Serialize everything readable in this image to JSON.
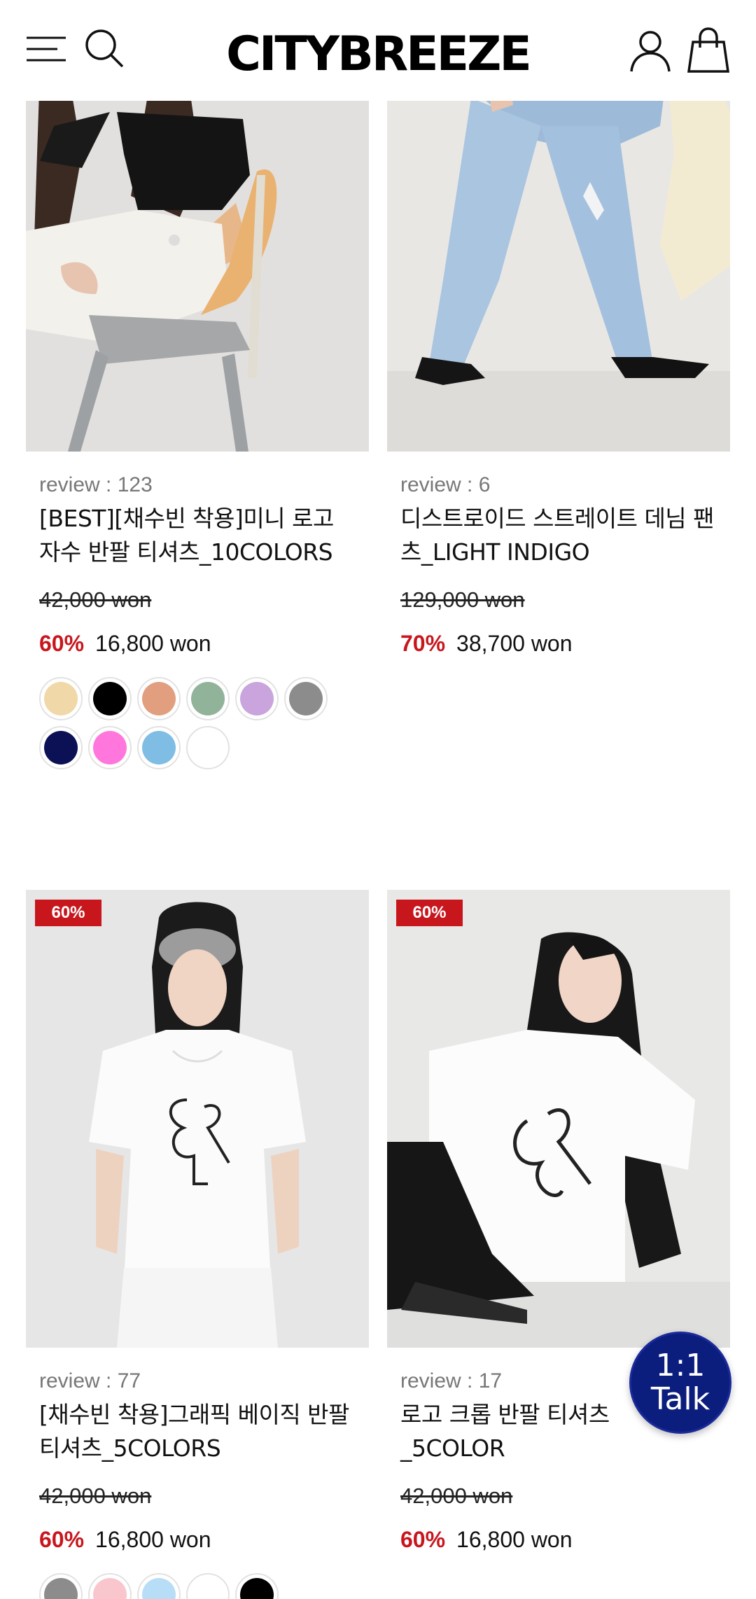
{
  "header": {
    "logo": "CITYBREEZE",
    "menu_icon": "hamburger-menu-icon",
    "search_icon": "search-icon",
    "user_icon": "user-icon",
    "cart_icon": "shopping-bag-icon"
  },
  "products": [
    {
      "review": "review : 123",
      "title_line1": "[BEST][채수빈 착용]미니 로고",
      "title_line2": "자수 반팔 티셔츠_10COLORS",
      "original_price": "42,000 won",
      "discount": "60%",
      "price": "16,800 won",
      "swatches": [
        "#f0d8a8",
        "#000000",
        "#e19f80",
        "#91b39a",
        "#c9a4dd",
        "#8c8c8c",
        "#0c1055",
        "#ff77dd",
        "#7fbde4",
        "#ffffff"
      ]
    },
    {
      "review": "review : 6",
      "title_line1": "디스트로이드 스트레이트 데님 팬",
      "title_line2": "츠_LIGHT INDIGO",
      "original_price": "129,000 won",
      "discount": "70%",
      "price": "38,700 won",
      "swatches": []
    },
    {
      "badge": "60%",
      "review": "review : 77",
      "title_line1": "[채수빈 착용]그래픽 베이직 반팔",
      "title_line2": "티셔츠_5COLORS",
      "original_price": "42,000 won",
      "discount": "60%",
      "price": "16,800 won",
      "swatches": [
        "#8c8c8c",
        "#f8c6cc",
        "#b8ddf7",
        "#ffffff",
        "#000000"
      ]
    },
    {
      "badge": "60%",
      "review": "review : 17",
      "title_line1": "로고 크롭 반팔 티셔츠",
      "title_line2": "_5COLOR",
      "original_price": "42,000 won",
      "discount": "60%",
      "price": "16,800 won",
      "swatches": []
    }
  ],
  "chat": {
    "line1": "1:1",
    "line2": "Talk",
    "color": "#0b1d7d"
  },
  "colors": {
    "accent": "#c8161d",
    "text": "#111111",
    "muted": "#777777"
  }
}
